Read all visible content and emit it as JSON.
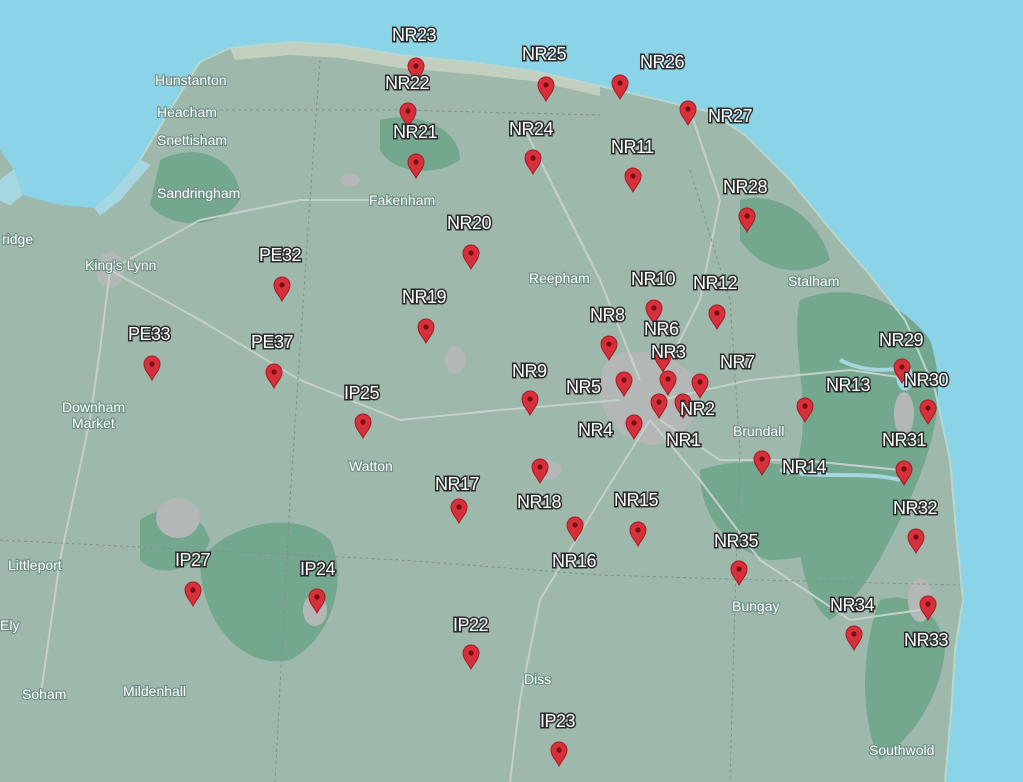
{
  "map": {
    "colors": {
      "sea": "#8bd3e6",
      "land": "#9fb8ac",
      "forest": "#74a88e",
      "urban": "#b3b8b6",
      "coast": "#c9d3c6",
      "water": "#a6d6df",
      "pin": "#d6303b"
    },
    "icon": "map-pin-icon"
  },
  "towns": [
    {
      "id": "hunstanton",
      "label": "Hunstanton"
    },
    {
      "id": "heacham",
      "label": "Heacham"
    },
    {
      "id": "snettisham",
      "label": "Snettisham"
    },
    {
      "id": "sandringham",
      "label": "Sandringham"
    },
    {
      "id": "fakenham",
      "label": "Fakenham"
    },
    {
      "id": "kings-lynn",
      "label": "King's Lynn"
    },
    {
      "id": "bridge",
      "label": "ridge"
    },
    {
      "id": "reepham",
      "label": "Reepham"
    },
    {
      "id": "stalham",
      "label": "Stalham"
    },
    {
      "id": "downham",
      "label": "Downham"
    },
    {
      "id": "market",
      "label": "Market"
    },
    {
      "id": "watton",
      "label": "Watton"
    },
    {
      "id": "brundall",
      "label": "Brundall"
    },
    {
      "id": "littleport",
      "label": "Littleport"
    },
    {
      "id": "ely",
      "label": "Ely"
    },
    {
      "id": "bungay",
      "label": "Bungay"
    },
    {
      "id": "soham",
      "label": "Soham"
    },
    {
      "id": "mildenhall",
      "label": "Mildenhall"
    },
    {
      "id": "diss",
      "label": "Diss"
    },
    {
      "id": "southwold",
      "label": "Southwold"
    }
  ],
  "postcodes": [
    {
      "id": "NR23",
      "label": "NR23"
    },
    {
      "id": "NR22",
      "label": "NR22"
    },
    {
      "id": "NR25",
      "label": "NR25"
    },
    {
      "id": "NR26",
      "label": "NR26"
    },
    {
      "id": "NR27",
      "label": "NR27"
    },
    {
      "id": "NR21",
      "label": "NR21"
    },
    {
      "id": "NR24",
      "label": "NR24"
    },
    {
      "id": "NR11",
      "label": "NR11"
    },
    {
      "id": "NR28",
      "label": "NR28"
    },
    {
      "id": "NR20",
      "label": "NR20"
    },
    {
      "id": "PE32",
      "label": "PE32"
    },
    {
      "id": "NR10",
      "label": "NR10"
    },
    {
      "id": "NR12",
      "label": "NR12"
    },
    {
      "id": "NR19",
      "label": "NR19"
    },
    {
      "id": "NR8",
      "label": "NR8"
    },
    {
      "id": "NR6",
      "label": "NR6"
    },
    {
      "id": "PE33",
      "label": "PE33"
    },
    {
      "id": "PE37",
      "label": "PE37"
    },
    {
      "id": "NR3",
      "label": "NR3"
    },
    {
      "id": "NR7",
      "label": "NR7"
    },
    {
      "id": "NR29",
      "label": "NR29"
    },
    {
      "id": "NR30",
      "label": "NR30"
    },
    {
      "id": "NR9",
      "label": "NR9"
    },
    {
      "id": "NR5",
      "label": "NR5"
    },
    {
      "id": "NR13",
      "label": "NR13"
    },
    {
      "id": "IP25",
      "label": "IP25"
    },
    {
      "id": "NR2",
      "label": "NR2"
    },
    {
      "id": "NR4",
      "label": "NR4"
    },
    {
      "id": "NR1",
      "label": "NR1"
    },
    {
      "id": "NR31",
      "label": "NR31"
    },
    {
      "id": "NR14",
      "label": "NR14"
    },
    {
      "id": "NR17",
      "label": "NR17"
    },
    {
      "id": "NR18",
      "label": "NR18"
    },
    {
      "id": "NR15",
      "label": "NR15"
    },
    {
      "id": "NR32",
      "label": "NR32"
    },
    {
      "id": "NR16",
      "label": "NR16"
    },
    {
      "id": "NR35",
      "label": "NR35"
    },
    {
      "id": "IP27",
      "label": "IP27"
    },
    {
      "id": "IP24",
      "label": "IP24"
    },
    {
      "id": "NR34",
      "label": "NR34"
    },
    {
      "id": "NR33",
      "label": "NR33"
    },
    {
      "id": "IP22",
      "label": "IP22"
    },
    {
      "id": "IP23",
      "label": "IP23"
    }
  ]
}
